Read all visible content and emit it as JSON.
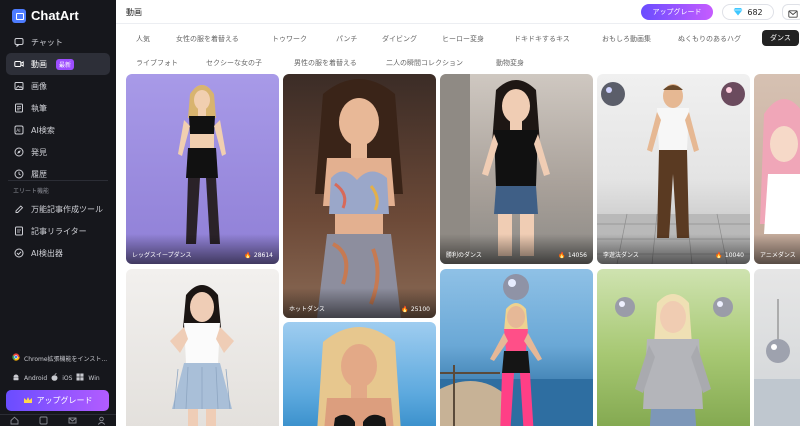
{
  "app": {
    "name": "ChatArt"
  },
  "sidebar": {
    "items": [
      {
        "label": "チャット",
        "icon": "chat-icon",
        "active": false
      },
      {
        "label": "動画",
        "icon": "video-icon",
        "active": true,
        "badge": "最新"
      },
      {
        "label": "画像",
        "icon": "image-icon",
        "active": false
      },
      {
        "label": "執筆",
        "icon": "write-icon",
        "active": false
      },
      {
        "label": "AI検索",
        "icon": "ai-search-icon",
        "active": false
      },
      {
        "label": "発見",
        "icon": "discover-icon",
        "active": false
      },
      {
        "label": "履歴",
        "icon": "history-icon",
        "active": false
      }
    ],
    "elite_title": "エリート機能",
    "elite_items": [
      {
        "label": "万能記事作成ツール",
        "icon": "article-tool-icon"
      },
      {
        "label": "記事リライター",
        "icon": "rewriter-icon"
      },
      {
        "label": "AI検出器",
        "icon": "ai-detector-icon"
      }
    ],
    "extension_text": "Chrome拡張機能をインスト...",
    "platforms": [
      "Android",
      "iOS",
      "Win"
    ],
    "upgrade_label": "アップグレード"
  },
  "header": {
    "title": "動画",
    "upgrade_label": "アップグレード",
    "credits": "682"
  },
  "categories_row1": [
    "人気",
    "女性の服を着替える",
    "トゥワーク",
    "パンチ",
    "ダイビング",
    "ヒーロー変身",
    "ドキドキするキス",
    "おもしろ動画集",
    "ぬくもりのあるハグ",
    "ダンス"
  ],
  "categories_row2": [
    "ライブフォト",
    "セクシーな女の子",
    "男性の服を着替える",
    "二人の瞬間コレクション",
    "動物変身"
  ],
  "active_category": "ダンス",
  "cards": [
    {
      "label": "レッグスイープダンス",
      "count": "28614"
    },
    {
      "label": "ホットダンス",
      "count": "25100"
    },
    {
      "label": "勝利のダンス",
      "count": "14056"
    },
    {
      "label": "李遊法ダンス",
      "count": "10040"
    },
    {
      "label": "アニメダンス",
      "count": ""
    },
    {
      "label": "",
      "count": ""
    },
    {
      "label": "",
      "count": ""
    },
    {
      "label": "",
      "count": ""
    },
    {
      "label": "",
      "count": ""
    },
    {
      "label": "",
      "count": ""
    }
  ],
  "colors": {
    "sidebar_bg": "#16171c",
    "accent": "#7b4dff",
    "active_tab": "#222222"
  }
}
